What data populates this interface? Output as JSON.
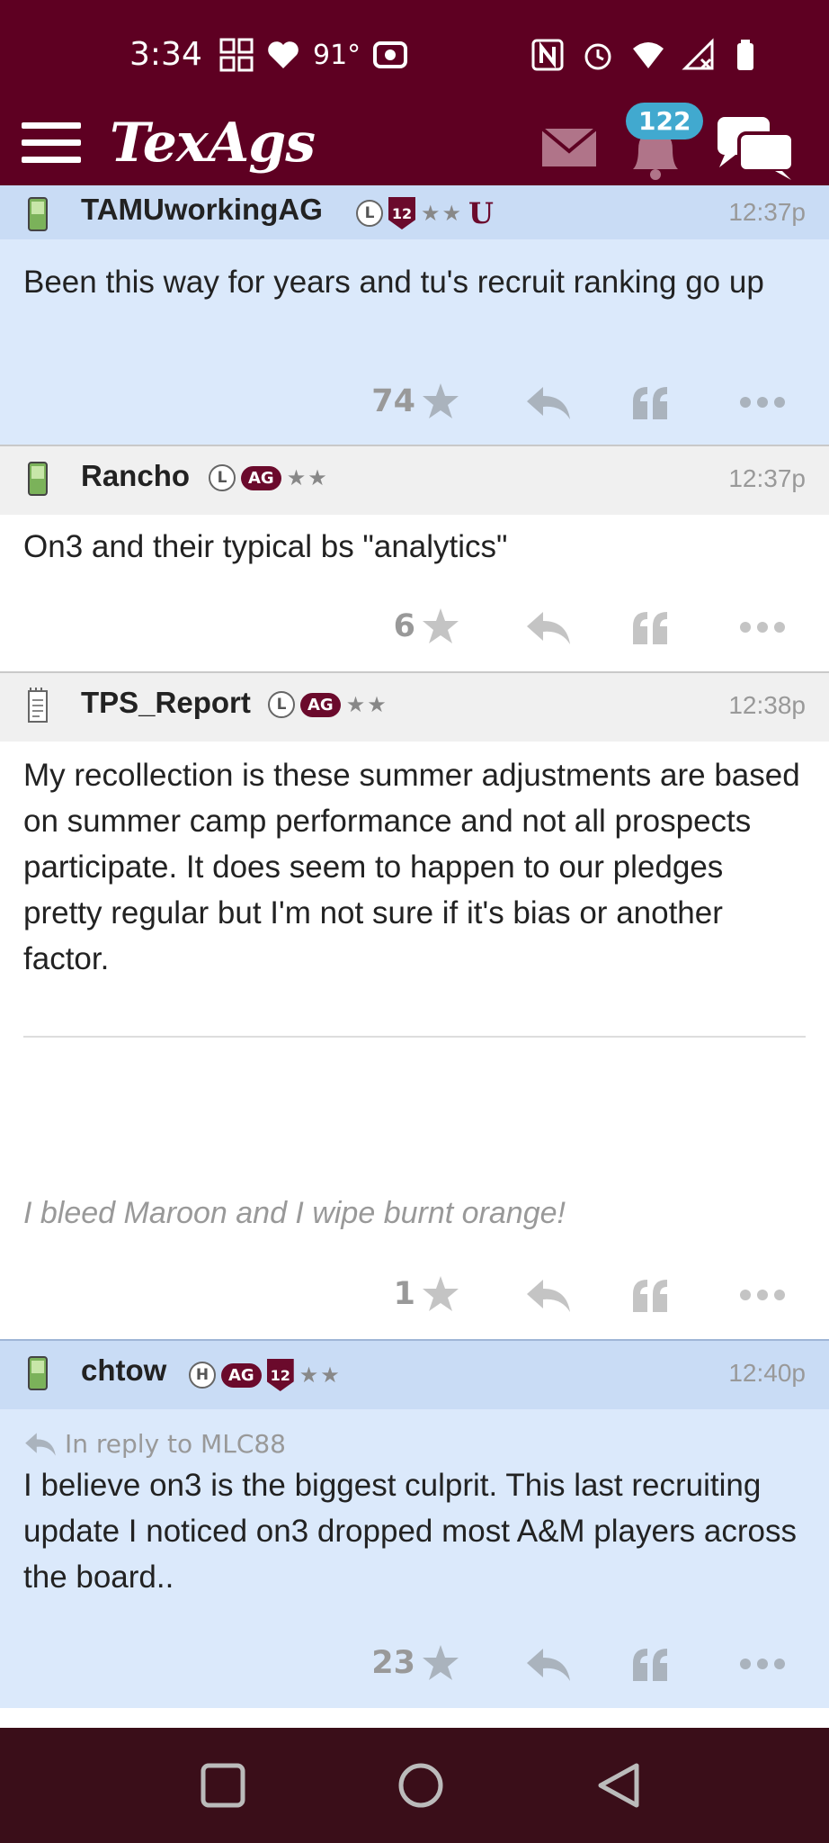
{
  "status_bar": {
    "time": "3:34",
    "temperature": "91°",
    "icons_left": [
      "grid-icon",
      "heart-icon",
      "camera-icon"
    ],
    "icons_right": [
      "nfc-icon",
      "alarm-icon",
      "wifi-icon",
      "signal-icon",
      "battery-icon"
    ]
  },
  "app_bar": {
    "logo": "TexAgs",
    "notification_count": "122"
  },
  "colors": {
    "brand": "#5e0022",
    "highlight_post": "#dbe9fb",
    "badge": "#41a9cf"
  },
  "posts": [
    {
      "username": "TAMUworkingAG",
      "badges": [
        "L",
        "12",
        "★★",
        "U"
      ],
      "time": "12:37p",
      "text": "Been this way for years and tu's recruit ranking go up",
      "likes": "74"
    },
    {
      "username": "Rancho",
      "badges": [
        "L",
        "AG",
        "★★"
      ],
      "time": "12:37p",
      "text": "On3 and their typical bs \"analytics\"",
      "likes": "6"
    },
    {
      "username": "TPS_Report",
      "badges": [
        "L",
        "AG",
        "★★"
      ],
      "time": "12:38p",
      "text": "My recollection is these summer adjustments are based on summer camp performance and not all prospects participate. It does seem to happen to our pledges pretty regular but I'm not sure if it's bias or another factor.",
      "signature": "I bleed Maroon and I wipe burnt orange!",
      "likes": "1"
    },
    {
      "username": "chtow",
      "badges": [
        "H",
        "AG",
        "12",
        "★★"
      ],
      "time": "12:40p",
      "reply_to": "In reply to MLC88",
      "text": "I believe on3 is the biggest culprit. This last recruiting update I noticed on3 dropped most A&M players across the board..",
      "likes": "23"
    }
  ]
}
